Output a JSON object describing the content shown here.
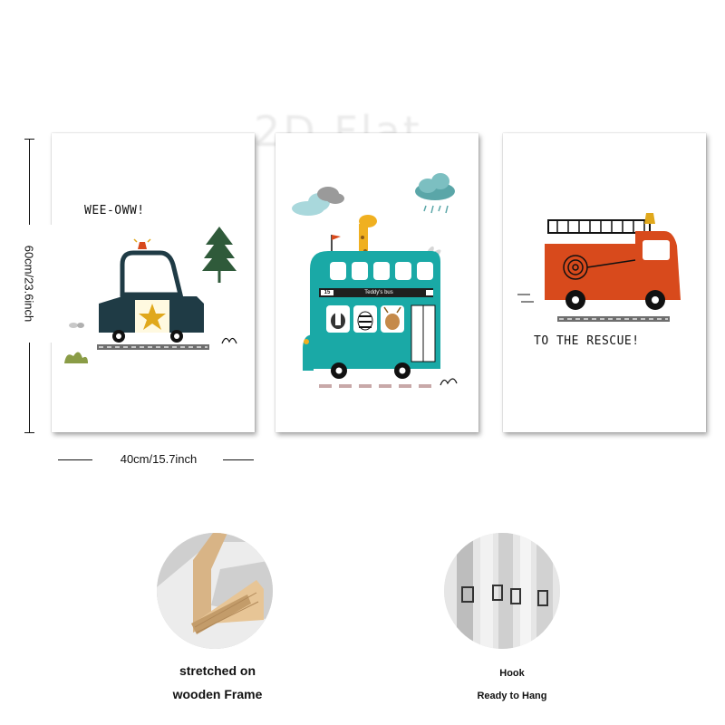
{
  "watermark": "2D Flat",
  "panels": {
    "police": {
      "text": "WEE-OWW!"
    },
    "bus": {
      "route_number": "15",
      "sign": "Teddy's bus"
    },
    "fire": {
      "text": "TO THE RESCUE!"
    }
  },
  "dimensions": {
    "height_label": "60cm/23.6inch",
    "width_label": "40cm/15.7inch"
  },
  "features": [
    {
      "icon": "wooden-frame-corner-icon",
      "line1": "stretched on",
      "line2": "wooden Frame"
    },
    {
      "icon": "hook-icon",
      "line1": "Hook",
      "line2": "Ready to Hang"
    }
  ],
  "colors": {
    "teal": "#1aa9a6",
    "fire_red": "#d84a1c",
    "police_navy": "#1f3b45",
    "star_gold": "#e0a81c",
    "tree_green": "#2f5a3a",
    "giraffe_yellow": "#f0b020"
  }
}
